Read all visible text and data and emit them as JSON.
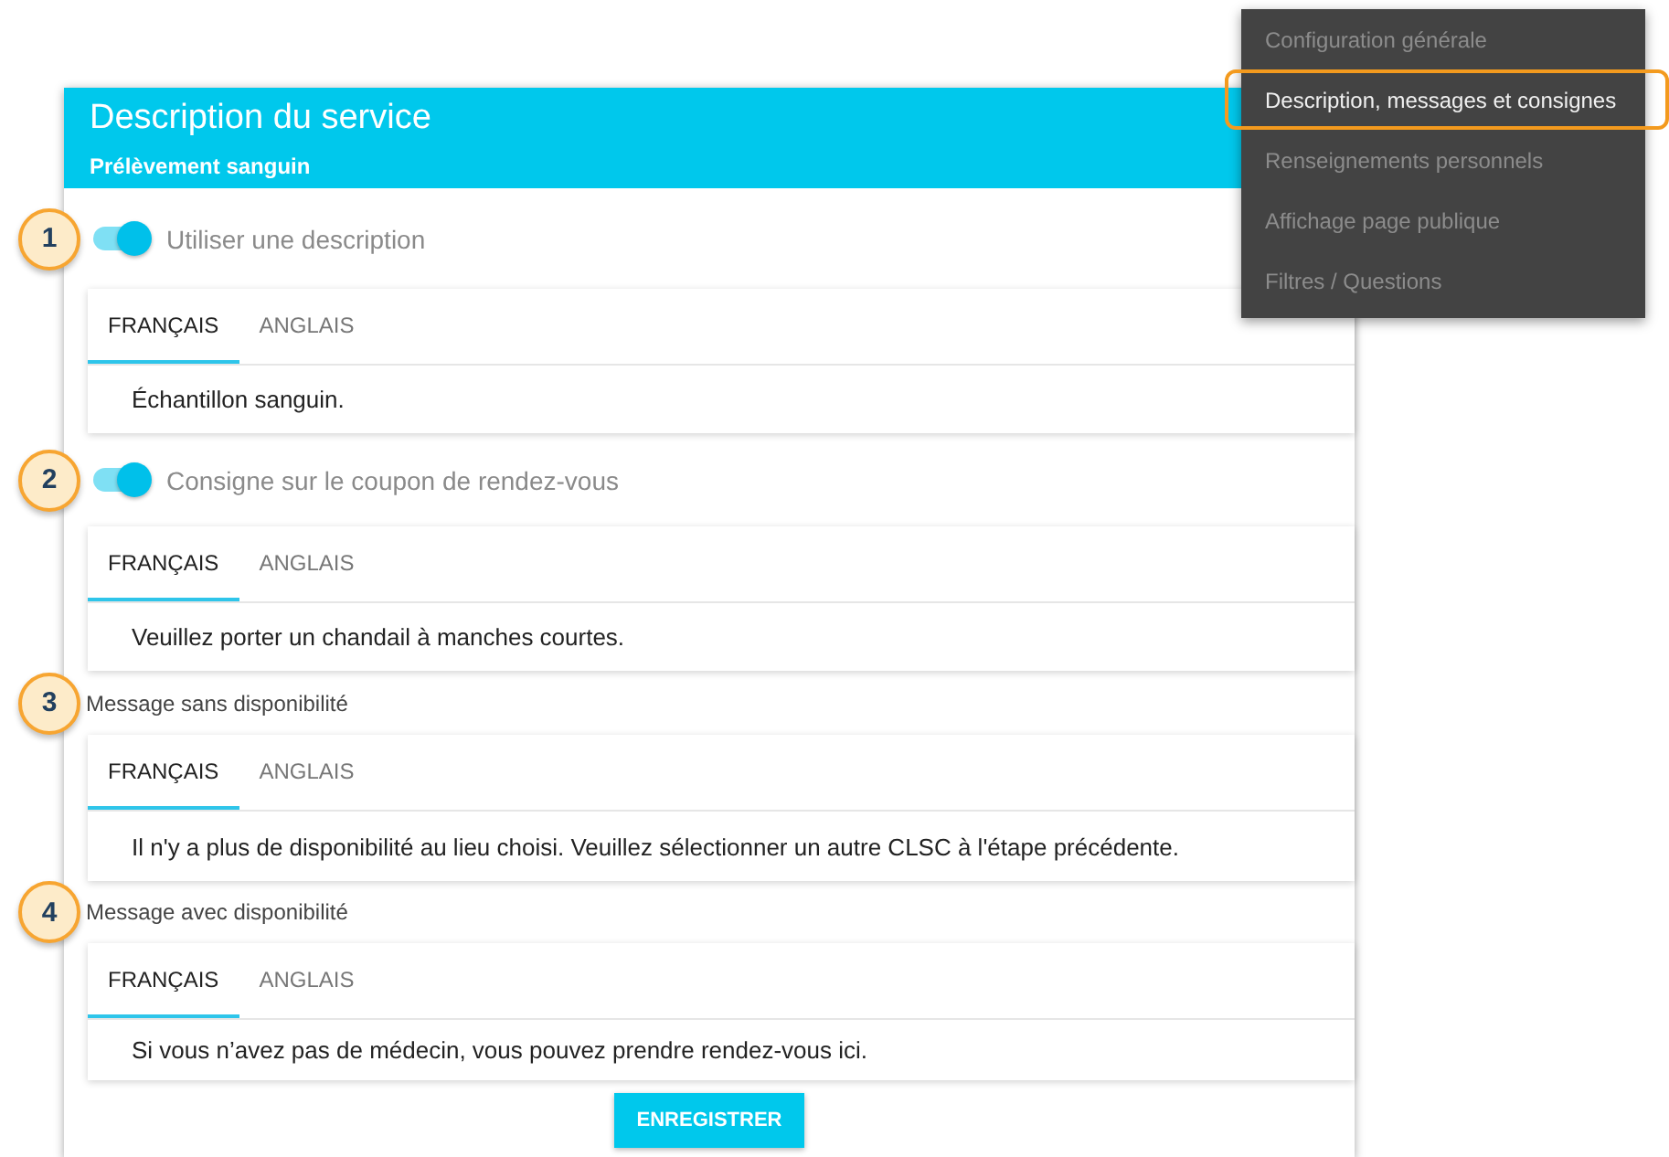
{
  "menu": [
    {
      "label": "Configuration générale",
      "selected": false
    },
    {
      "label": "Description, messages et consignes",
      "selected": true
    },
    {
      "label": "Renseignements personnels",
      "selected": false
    },
    {
      "label": "Affichage page publique",
      "selected": false
    },
    {
      "label": "Filtres / Questions",
      "selected": false
    }
  ],
  "panel": {
    "title": "Description du service",
    "subtitle": "Prélèvement sanguin"
  },
  "sections": [
    {
      "callout": "1",
      "kind": "toggle",
      "on": true,
      "label": "Utiliser une description",
      "tabs": [
        {
          "label": "FRANÇAIS",
          "selected": true
        },
        {
          "label": "ANGLAIS",
          "selected": false
        }
      ],
      "text": "Échantillon sanguin."
    },
    {
      "callout": "2",
      "kind": "toggle",
      "on": true,
      "label": "Consigne sur le coupon de rendez-vous",
      "tabs": [
        {
          "label": "FRANÇAIS",
          "selected": true
        },
        {
          "label": "ANGLAIS",
          "selected": false
        }
      ],
      "text": "Veuillez porter un chandail à manches courtes."
    },
    {
      "callout": "3",
      "kind": "label",
      "label": "Message sans disponibilité",
      "tabs": [
        {
          "label": "FRANÇAIS",
          "selected": true
        },
        {
          "label": "ANGLAIS",
          "selected": false
        }
      ],
      "text": "Il n'y a plus de disponibilité au lieu choisi. Veuillez sélectionner un autre CLSC à l'étape précédente."
    },
    {
      "callout": "4",
      "kind": "label",
      "label": "Message avec disponibilité",
      "tabs": [
        {
          "label": "FRANÇAIS",
          "selected": true
        },
        {
          "label": "ANGLAIS",
          "selected": false
        }
      ],
      "text": "Si vous n’avez pas de médecin, vous pouvez prendre rendez-vous ici."
    }
  ],
  "save_button": "ENREGISTRER"
}
